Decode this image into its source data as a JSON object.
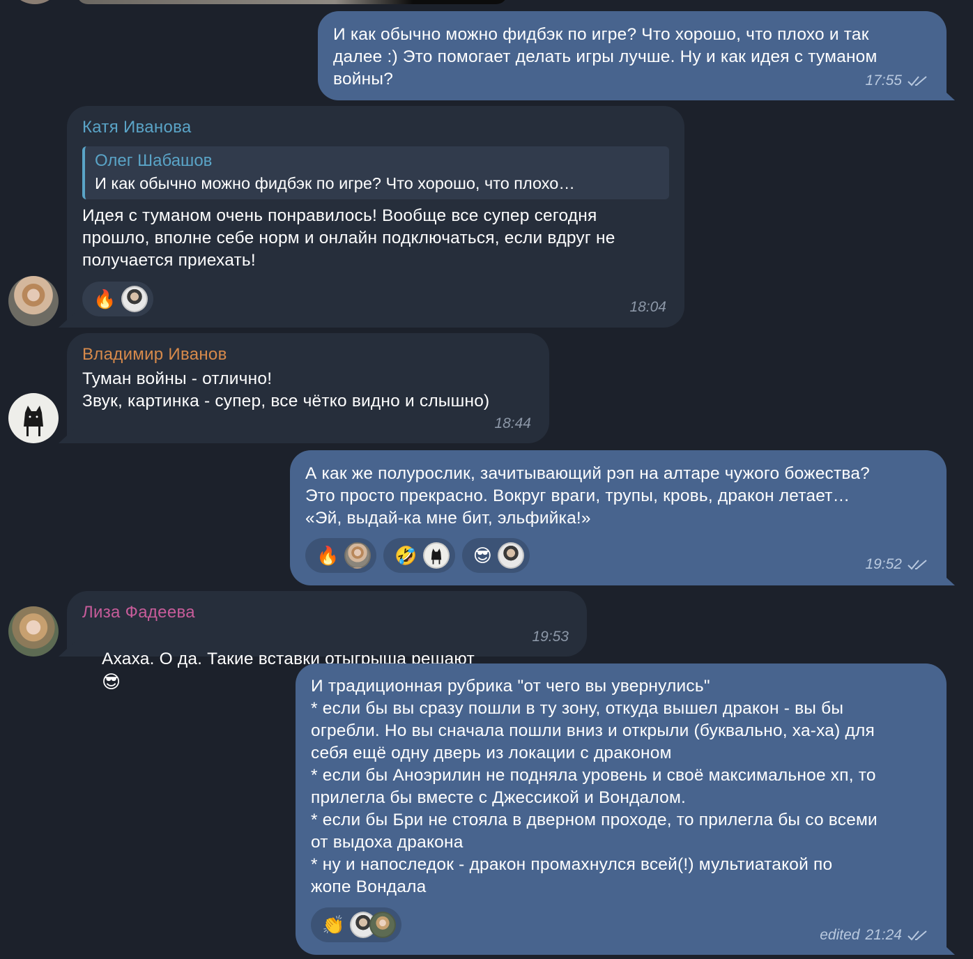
{
  "messages": [
    {
      "text": "И как обычно можно фидбэк по игре? Что хорошо, что плохо и так\nдалее :) Это помогает делать игры лучше. Ну и как идея с туманом\nвойны?",
      "time": "17:55"
    },
    {
      "sender": "Катя Иванова",
      "reply_sender": "Олег Шабашов",
      "reply_text": "И как обычно можно фидбэк по игре? Что хорошо, что плохо…",
      "text": "Идея с туманом очень понравилось! Вообще все супер сегодня\nпрошло, вполне себе норм и онлайн подключаться, если вдруг не\nполучается приехать!",
      "reactions": [
        {
          "emoji": "🔥"
        }
      ],
      "time": "18:04"
    },
    {
      "sender": "Владимир Иванов",
      "text": "Туман войны - отлично!\nЗвук, картинка - супер, все чётко видно и слышно)",
      "time": "18:44"
    },
    {
      "text": "А как же полурослик, зачитывающий рэп на алтаре чужого божества?\nЭто просто прекрасно. Вокруг враги, трупы, кровь, дракон летает…\n«Эй, выдай-ка мне бит, эльфийка!»",
      "reactions": [
        {
          "emoji": "🔥"
        },
        {
          "emoji": "🤣"
        },
        {
          "emoji": "😎"
        }
      ],
      "time": "19:52"
    },
    {
      "sender": "Лиза Фадеева",
      "text": "Ахаха. О да. Такие вставки отыгрыша решают",
      "emoji": "😎",
      "time": "19:53"
    },
    {
      "text": "И традиционная рубрика \"от чего вы увернулись\"\n* если бы вы сразу пошли в ту зону, откуда вышел дракон - вы бы\nогребли. Но вы сначала пошли вниз и открыли (буквально, ха-ха) для\nсебя ещё одну дверь из локации с драконом\n* если бы Аноэрилин не подняла уровень и своё максимальное хп, то\nприлегла бы вместе с Джессикой и Вондалом.\n* если бы Бри не стояла в дверном проходе, то прилегла бы со всеми\nот выдоха дракона\n* ну и напоследок - дракон промахнулся всей(!) мультиатакой по\nжопе Вондала",
      "reactions": [
        {
          "emoji": "👏"
        }
      ],
      "edited_label": "edited",
      "time": "21:24"
    }
  ],
  "colors": {
    "background": "#1c212b",
    "outgoing_bubble": "#48648e",
    "incoming_bubble": "#262e3b",
    "sender_katya": "#5aa4c7",
    "sender_vladimir": "#d78a4b",
    "sender_liza": "#c75c9a"
  }
}
